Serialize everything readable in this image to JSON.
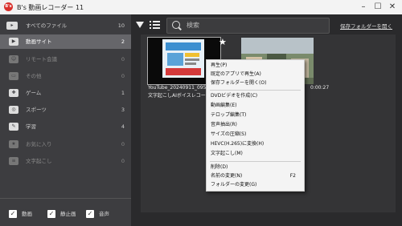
{
  "window": {
    "logo_text": "B's",
    "title": "B's 動画レコーダー 11",
    "minimize": "–",
    "maximize": "☐",
    "close": "✕"
  },
  "sidebar": {
    "items": [
      {
        "label": "すべてのファイル",
        "count": "10",
        "icon": "all-files-icon"
      },
      {
        "label": "動画サイト",
        "count": "2",
        "icon": "video-site-icon"
      },
      {
        "label": "リモート会議",
        "count": "0",
        "icon": "remote-meeting-icon"
      },
      {
        "label": "その他",
        "count": "0",
        "icon": "other-icon"
      },
      {
        "label": "ゲーム",
        "count": "1",
        "icon": "game-icon"
      },
      {
        "label": "スポーツ",
        "count": "3",
        "icon": "sports-icon"
      },
      {
        "label": "学習",
        "count": "4",
        "icon": "study-icon"
      },
      {
        "label": "お気に入り",
        "count": "0",
        "icon": "favorite-icon"
      },
      {
        "label": "文字起こし",
        "count": "0",
        "icon": "transcription-icon"
      }
    ],
    "filters": [
      {
        "label": "動画",
        "checked": true
      },
      {
        "label": "静止画",
        "checked": true
      },
      {
        "label": "音声",
        "checked": true
      }
    ]
  },
  "toolbar": {
    "search_placeholder": "検索",
    "open_folder_link": "保存フォルダーを開く"
  },
  "files": [
    {
      "name": "YouTube_20240911_09540",
      "subtitle": "文字起こしAIボイスレコーダー",
      "selected": true
    },
    {
      "name": "",
      "subtitle": "",
      "duration": "0:00:27"
    }
  ],
  "context_menu": {
    "groups": [
      [
        {
          "label": "再生(P)"
        },
        {
          "label": "既定のアプリで再生(A)"
        },
        {
          "label": "保存フォルダーを開く(O)"
        }
      ],
      [
        {
          "label": "DVDビデオを作成(C)"
        },
        {
          "label": "動画編集(E)"
        },
        {
          "label": "テロップ編集(T)"
        },
        {
          "label": "音声抽出(R)"
        },
        {
          "label": "サイズの圧縮(S)"
        },
        {
          "label": "HEVC(H.265)に変換(H)"
        },
        {
          "label": "文字起こし(M)"
        }
      ],
      [
        {
          "label": "削除(D)"
        },
        {
          "label": "名前の変更(N)",
          "shortcut": "F2"
        },
        {
          "label": "フォルダーの変更(G)"
        }
      ]
    ]
  },
  "colors": {
    "accent_red": "#d9302c",
    "sidebar_bg": "#3d3d40",
    "active_item_bg": "#66666a",
    "content_bg": "#2a2a2c"
  }
}
